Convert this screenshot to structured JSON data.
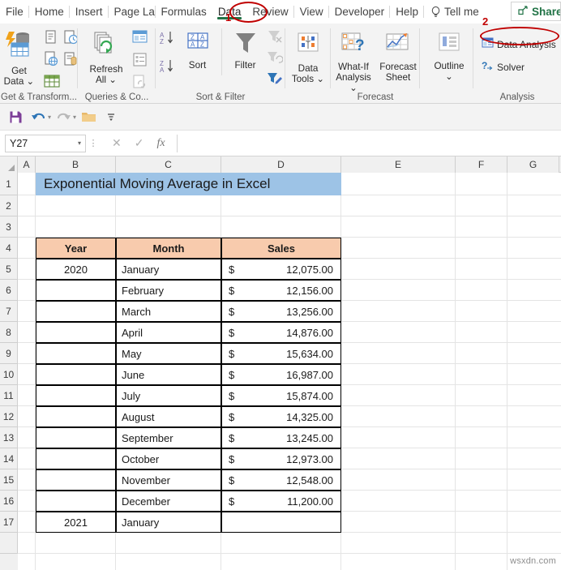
{
  "ribbon": {
    "tabs": [
      {
        "label": "File",
        "active": false
      },
      {
        "label": "Home",
        "active": false
      },
      {
        "label": "Insert",
        "active": false
      },
      {
        "label": "Page Layout",
        "active": false
      },
      {
        "label": "Formulas",
        "active": false
      },
      {
        "label": "Data",
        "active": true
      },
      {
        "label": "Review",
        "active": false
      },
      {
        "label": "View",
        "active": false
      },
      {
        "label": "Developer",
        "active": false
      },
      {
        "label": "Help",
        "active": false
      }
    ],
    "tell_me": "Tell me",
    "share": "Share",
    "groups": [
      {
        "name": "get-transform",
        "label": "Get & Transform...",
        "buttons": [
          {
            "label": "Get\nData ⌄",
            "icon": "get-data-icon"
          }
        ]
      },
      {
        "name": "queries-connections",
        "label": "Queries & Co...",
        "buttons": [
          {
            "label": "Refresh\nAll ⌄",
            "icon": "refresh-all-icon"
          }
        ]
      },
      {
        "name": "sort-filter",
        "label": "Sort & Filter",
        "buttons": [
          {
            "label": "Sort",
            "icon": "sort-icon"
          },
          {
            "label": "Filter",
            "icon": "filter-icon"
          }
        ]
      },
      {
        "name": "data-tools",
        "label": "",
        "buttons": [
          {
            "label": "Data\nTools ⌄",
            "icon": "data-tools-icon"
          }
        ]
      },
      {
        "name": "forecast",
        "label": "Forecast",
        "buttons": [
          {
            "label": "What-If\nAnalysis ⌄",
            "icon": "what-if-analysis-icon"
          },
          {
            "label": "Forecast\nSheet",
            "icon": "forecast-sheet-icon"
          }
        ]
      },
      {
        "name": "outline",
        "label": "",
        "buttons": [
          {
            "label": "Outline\n⌄",
            "icon": "outline-icon"
          }
        ]
      },
      {
        "name": "analysis",
        "label": "Analysis",
        "buttons": [
          {
            "label": "Data Analysis",
            "icon": "data-analysis-icon"
          },
          {
            "label": "Solver",
            "icon": "solver-icon"
          }
        ]
      }
    ]
  },
  "quick_access": {
    "items": [
      "save-icon",
      "undo-icon",
      "redo-icon",
      "open-folder-icon",
      "customize-qat-icon"
    ]
  },
  "formula_bar": {
    "name_box_value": "Y27",
    "cancel_icon": "✕",
    "enter_icon": "✓",
    "function_icon": "fx",
    "formula_value": ""
  },
  "grid": {
    "columns": [
      "A",
      "B",
      "C",
      "D",
      "E",
      "F",
      "G"
    ],
    "rows": [
      "1",
      "2",
      "3",
      "4",
      "5",
      "6",
      "7",
      "8",
      "9",
      "10",
      "11",
      "12",
      "13",
      "14",
      "15",
      "16",
      "17"
    ],
    "title_cell": "Exponential Moving Average in Excel",
    "title_fill": "#9DC3E6",
    "header_fill": "#F8CBAD"
  },
  "table": {
    "headers": [
      "Year",
      "Month",
      "Sales"
    ],
    "rows": [
      {
        "year": "2020",
        "month": "January",
        "cur": "$",
        "sales": "12,075.00"
      },
      {
        "year": "",
        "month": "February",
        "cur": "$",
        "sales": "12,156.00"
      },
      {
        "year": "",
        "month": "March",
        "cur": "$",
        "sales": "13,256.00"
      },
      {
        "year": "",
        "month": "April",
        "cur": "$",
        "sales": "14,876.00"
      },
      {
        "year": "",
        "month": "May",
        "cur": "$",
        "sales": "15,634.00"
      },
      {
        "year": "",
        "month": "June",
        "cur": "$",
        "sales": "16,987.00"
      },
      {
        "year": "",
        "month": "July",
        "cur": "$",
        "sales": "15,874.00"
      },
      {
        "year": "",
        "month": "August",
        "cur": "$",
        "sales": "14,325.00"
      },
      {
        "year": "",
        "month": "September",
        "cur": "$",
        "sales": "13,245.00"
      },
      {
        "year": "",
        "month": "October",
        "cur": "$",
        "sales": "12,973.00"
      },
      {
        "year": "",
        "month": "November",
        "cur": "$",
        "sales": "12,548.00"
      },
      {
        "year": "",
        "month": "December",
        "cur": "$",
        "sales": "11,200.00"
      },
      {
        "year": "2021",
        "month": "January",
        "cur": "",
        "sales": ""
      }
    ]
  },
  "annotations": [
    {
      "number": "1",
      "target": "Data"
    },
    {
      "number": "2",
      "target": "Data Analysis"
    }
  ],
  "watermark": "wsxdn.com"
}
